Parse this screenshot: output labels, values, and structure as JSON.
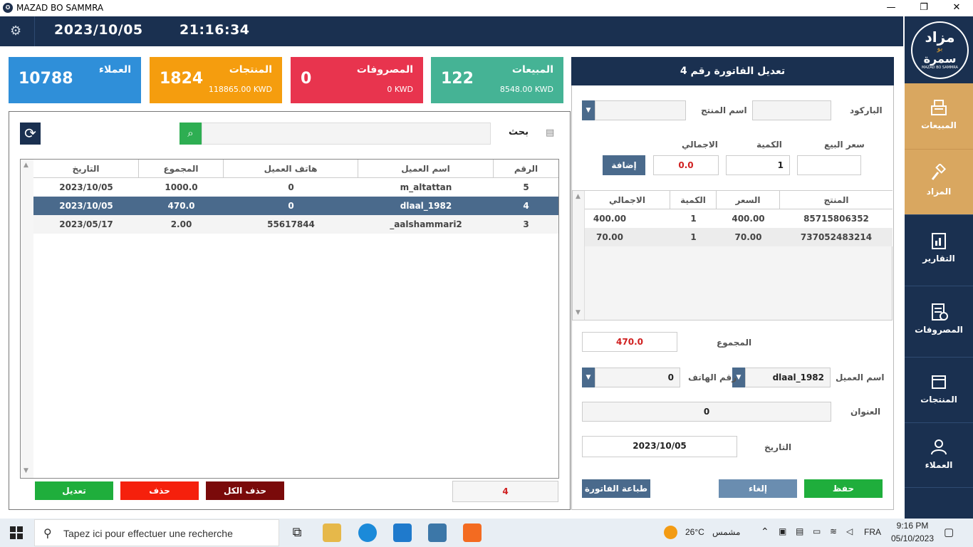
{
  "window": {
    "title": "MAZAD BO SAMMRA",
    "minimize": "—",
    "maximize": "❐",
    "close": "✕"
  },
  "header": {
    "date": "2023/10/05",
    "time": "21:16:34",
    "settings_icon": "gear-icon"
  },
  "logo": {
    "line1": "مزاد",
    "line2": "بو",
    "line3": "سمرة",
    "line4": "MAZAD BO SAMMRA"
  },
  "nav": [
    {
      "label": "المبيعات",
      "icon": "cash-register-icon"
    },
    {
      "label": "المزاد",
      "icon": "gavel-icon"
    },
    {
      "label": "التقارير",
      "icon": "report-icon"
    },
    {
      "label": "المصروفات",
      "icon": "expenses-icon"
    },
    {
      "label": "المنتجات",
      "icon": "box-icon"
    },
    {
      "label": "العملاء",
      "icon": "users-icon"
    }
  ],
  "cards": [
    {
      "label": "العملاء",
      "value": "10788",
      "sub": "",
      "color": "#2f8fd9"
    },
    {
      "label": "المنتجات",
      "value": "1824",
      "sub": "118865.00 KWD",
      "color": "#f59d0e"
    },
    {
      "label": "المصروفات",
      "value": "0",
      "sub": "0 KWD",
      "color": "#e8344e"
    },
    {
      "label": "المبيعات",
      "value": "122",
      "sub": "8548.00 KWD",
      "color": "#45b395"
    }
  ],
  "search": {
    "label": "بحث",
    "placeholder": "",
    "value": ""
  },
  "invoices": {
    "columns": [
      "الرقم",
      "اسم العميل",
      "هاتف العميل",
      "المجموع",
      "التاريخ"
    ],
    "rows": [
      {
        "id": "5",
        "name": "m_altattan",
        "phone": "0",
        "total": "1000.0",
        "date": "2023/10/05"
      },
      {
        "id": "4",
        "name": "dlaal_1982",
        "phone": "0",
        "total": "470.0",
        "date": "2023/10/05"
      },
      {
        "id": "3",
        "name": "_aalshammari2",
        "phone": "55617844",
        "total": "2.00",
        "date": "2023/05/17"
      }
    ],
    "count": "4"
  },
  "left_buttons": {
    "edit": "تعديل",
    "delete": "حذف",
    "delete_all": "حذف الكل"
  },
  "form": {
    "title": "تعديل الفاتورة رقم  4",
    "barcode_label": "الباركود",
    "barcode_value": "",
    "product_name_label": "اسم المنتج",
    "product_name_value": "",
    "sale_price_label": "سعر البيع",
    "sale_price_value": "",
    "qty_label": "الكمية",
    "qty_value": "1",
    "total_label": "الاجمالي",
    "total_value": "0.0",
    "add_button": "إضافة",
    "items_columns": [
      "المنتج",
      "السعر",
      "الكمية",
      "الاجمالي"
    ],
    "items": [
      {
        "product": "85715806352",
        "price": "400.00",
        "qty": "1",
        "total": "400.00"
      },
      {
        "product": "737052483214",
        "price": "70.00",
        "qty": "1",
        "total": "70.00"
      }
    ],
    "sum_label": "المجموع",
    "sum_value": "470.0",
    "customer_label": "اسم العميل",
    "customer_value": "dlaal_1982",
    "phone_label": "رقم الهاتف",
    "phone_value": "0",
    "address_label": "العنوان",
    "address_value": "0",
    "date_label": "التاريخ",
    "date_value": "2023/10/05",
    "save_button": "حفظ",
    "cancel_button": "إلغاء",
    "print_button": "طباعة الفاتورة"
  },
  "taskbar": {
    "search_placeholder": "Tapez ici pour effectuer une recherche",
    "weather_temp": "26°C",
    "weather_label": "مشمس",
    "lang": "FRA",
    "time": "9:16 PM",
    "date": "05/10/2023"
  }
}
